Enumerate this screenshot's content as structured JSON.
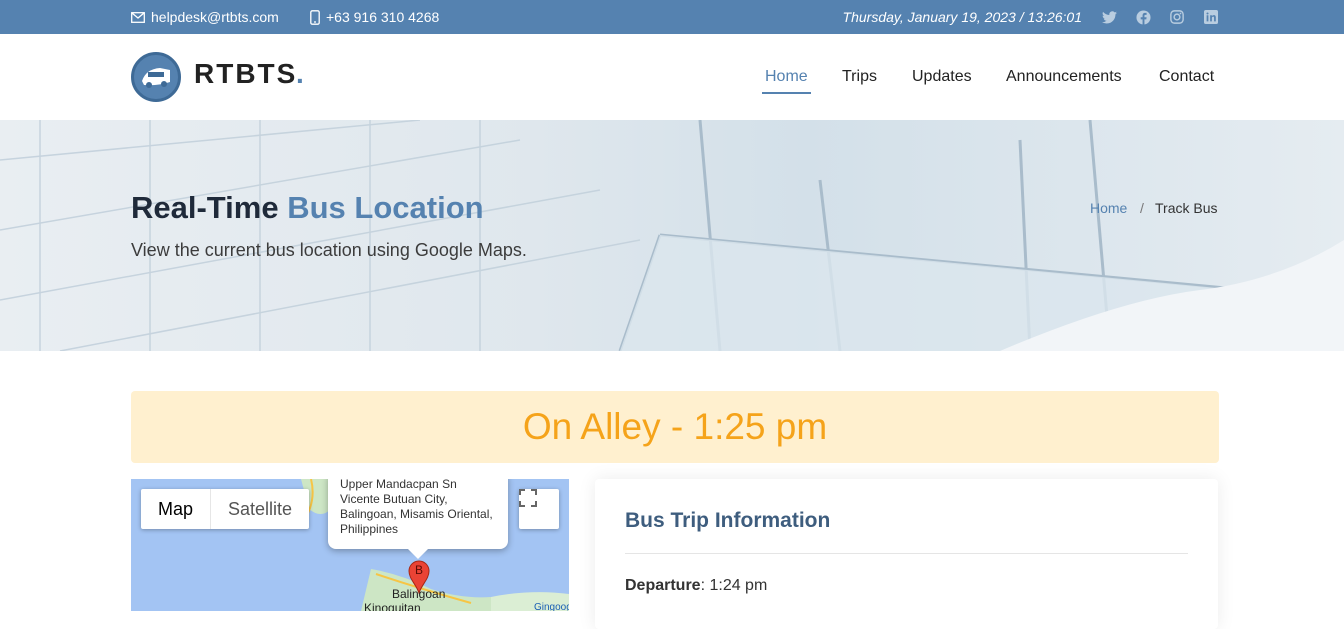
{
  "topbar": {
    "email": "helpdesk@rtbts.com",
    "phone": "+63 916 310 4268",
    "datetime": "Thursday, January 19, 2023 / 13:26:01",
    "social": [
      "twitter-icon",
      "facebook-icon",
      "instagram-icon",
      "linkedin-icon"
    ]
  },
  "header": {
    "logo_text": "RTBTS",
    "logo_dot": ".",
    "nav": [
      "Home",
      "Trips",
      "Updates",
      "Announcements",
      "Contact"
    ],
    "active_nav": "Home"
  },
  "hero": {
    "title_main": "Real-Time",
    "title_accent": "Bus Location",
    "subtitle": "View the current bus location using Google Maps.",
    "breadcrumb_home": "Home",
    "breadcrumb_sep": "/",
    "breadcrumb_current": "Track Bus"
  },
  "status": {
    "text": "On Alley - 1:25 pm",
    "color": "#f5a31a",
    "background": "#fff0cf"
  },
  "map": {
    "type_map": "Map",
    "type_satellite": "Satellite",
    "popup_address": "Upper Mandacpan Sn Vicente Butuan City, Balingoan, Misamis Oriental, Philippines",
    "marker_letter": "B",
    "place_label": "Balingoan",
    "place_label_2": "Kinoguitan",
    "place_label_3": "Gingoog"
  },
  "trip": {
    "title": "Bus Trip Information",
    "departure_label": "Departure",
    "departure_value": "1:24 pm"
  },
  "colors": {
    "accent": "#5582b0",
    "topbar": "#5582b0"
  }
}
